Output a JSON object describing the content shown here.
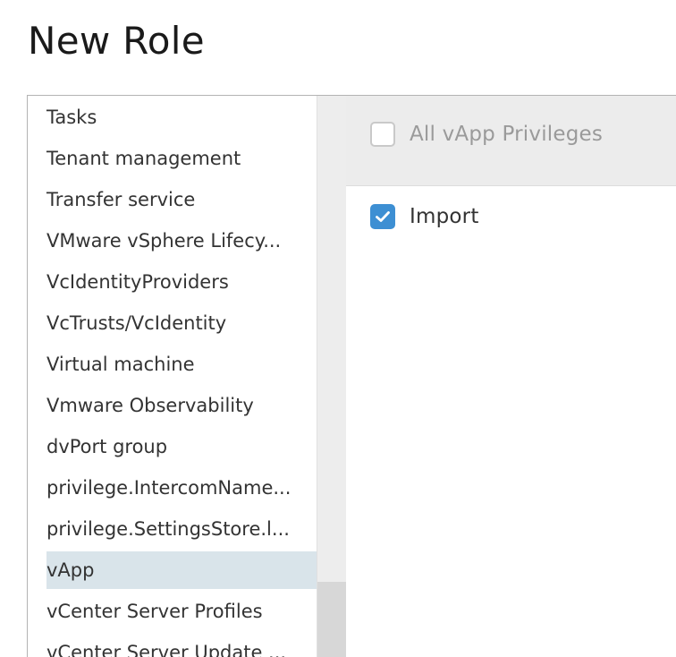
{
  "page": {
    "title": "New Role"
  },
  "categories": [
    {
      "label": "Tasks",
      "selected": false
    },
    {
      "label": "Tenant management",
      "selected": false
    },
    {
      "label": "Transfer service",
      "selected": false
    },
    {
      "label": "VMware vSphere Lifecy...",
      "selected": false
    },
    {
      "label": "VcIdentityProviders",
      "selected": false
    },
    {
      "label": "VcTrusts/VcIdentity",
      "selected": false
    },
    {
      "label": "Virtual machine",
      "selected": false
    },
    {
      "label": "Vmware Observability",
      "selected": false
    },
    {
      "label": "dvPort group",
      "selected": false
    },
    {
      "label": "privilege.IntercomName...",
      "selected": false
    },
    {
      "label": "privilege.SettingsStore.l...",
      "selected": false
    },
    {
      "label": "vApp",
      "selected": true
    },
    {
      "label": "vCenter Server Profiles",
      "selected": false
    },
    {
      "label": "vCenter Server Update ...",
      "selected": false
    }
  ],
  "privileges": {
    "all": {
      "label": "All vApp Privileges",
      "checked": false,
      "disabled": true
    },
    "items": [
      {
        "label": "Import",
        "checked": true
      }
    ]
  },
  "colors": {
    "accent": "#3d8fd3",
    "selected_row": "#d9e4ea",
    "header_bg": "#ececec"
  },
  "icons": {
    "check": "check-icon"
  }
}
